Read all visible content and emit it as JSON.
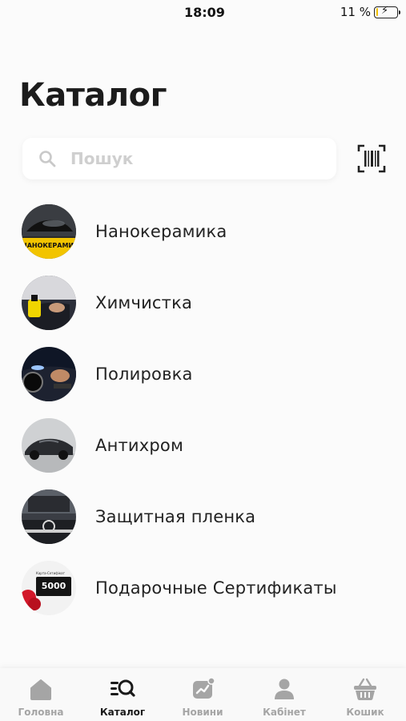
{
  "status_bar": {
    "time": "18:09",
    "battery_percent": "11 %",
    "battery_level": 0.11,
    "charging": true
  },
  "page": {
    "title": "Каталог"
  },
  "search": {
    "placeholder": "Пошук",
    "value": ""
  },
  "categories": [
    {
      "label": "Нанокерамика",
      "thumb_text": "НАНОКЕРАМИКА",
      "thumb_icon": "car-photo-icon"
    },
    {
      "label": "Химчистка",
      "thumb_icon": "interior-cleaning-photo-icon"
    },
    {
      "label": "Полировка",
      "thumb_icon": "polishing-photo-icon"
    },
    {
      "label": "Антихром",
      "thumb_icon": "black-car-photo-icon"
    },
    {
      "label": "Защитная пленка",
      "thumb_icon": "engine-photo-icon"
    },
    {
      "label": "Подарочные Сертификаты",
      "thumb_text": "5000",
      "thumb_caption": "Карта-Сетифікат",
      "thumb_icon": "gift-card-photo-icon"
    }
  ],
  "tabbar": {
    "active": "catalog",
    "tabs": [
      {
        "key": "home",
        "label": "Головна",
        "icon": "home-icon"
      },
      {
        "key": "catalog",
        "label": "Каталог",
        "icon": "catalog-search-icon"
      },
      {
        "key": "news",
        "label": "Новини",
        "icon": "news-chart-icon"
      },
      {
        "key": "account",
        "label": "Кабінет",
        "icon": "user-icon"
      },
      {
        "key": "cart",
        "label": "Кошик",
        "icon": "basket-icon"
      }
    ]
  },
  "colors": {
    "background": "#fbfbfb",
    "text": "#222222",
    "inactive_tab": "#a5a5a5",
    "battery_fill": "#f2c100"
  }
}
